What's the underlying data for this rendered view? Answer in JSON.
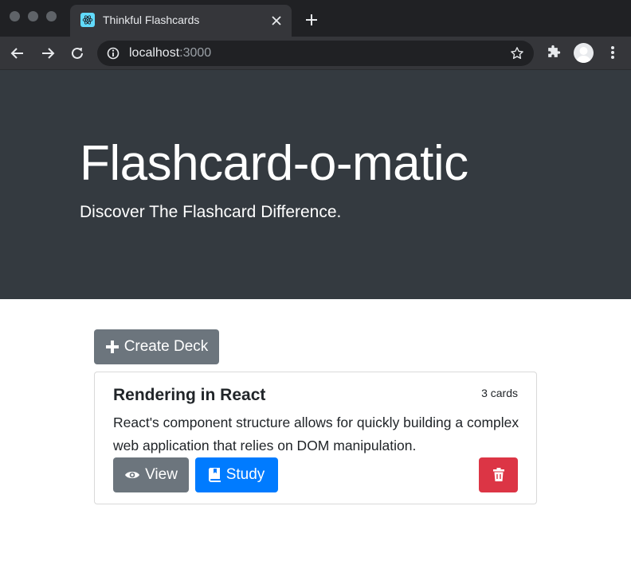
{
  "browser": {
    "tab": {
      "title": "Thinkful Flashcards",
      "favicon": "react-logo-icon"
    },
    "address": {
      "host": "localhost",
      "port": ":3000"
    },
    "icons": [
      "back-arrow-icon",
      "forward-arrow-icon",
      "reload-icon",
      "info-icon",
      "star-icon",
      "extensions-icon",
      "avatar",
      "kebab-menu-icon"
    ]
  },
  "header": {
    "title": "Flashcard-o-matic",
    "subtitle": "Discover The Flashcard Difference."
  },
  "actions": {
    "create_deck_label": "Create Deck"
  },
  "decks": [
    {
      "name": "Rendering in React",
      "count_label": "3 cards",
      "description": "React's component structure allows for quickly building a complex web application that relies on DOM manipulation.",
      "view_label": "View",
      "study_label": "Study"
    }
  ],
  "colors": {
    "jumbotron": "#343a40",
    "secondary": "#6c757d",
    "primary": "#007bff",
    "danger": "#dc3545"
  }
}
